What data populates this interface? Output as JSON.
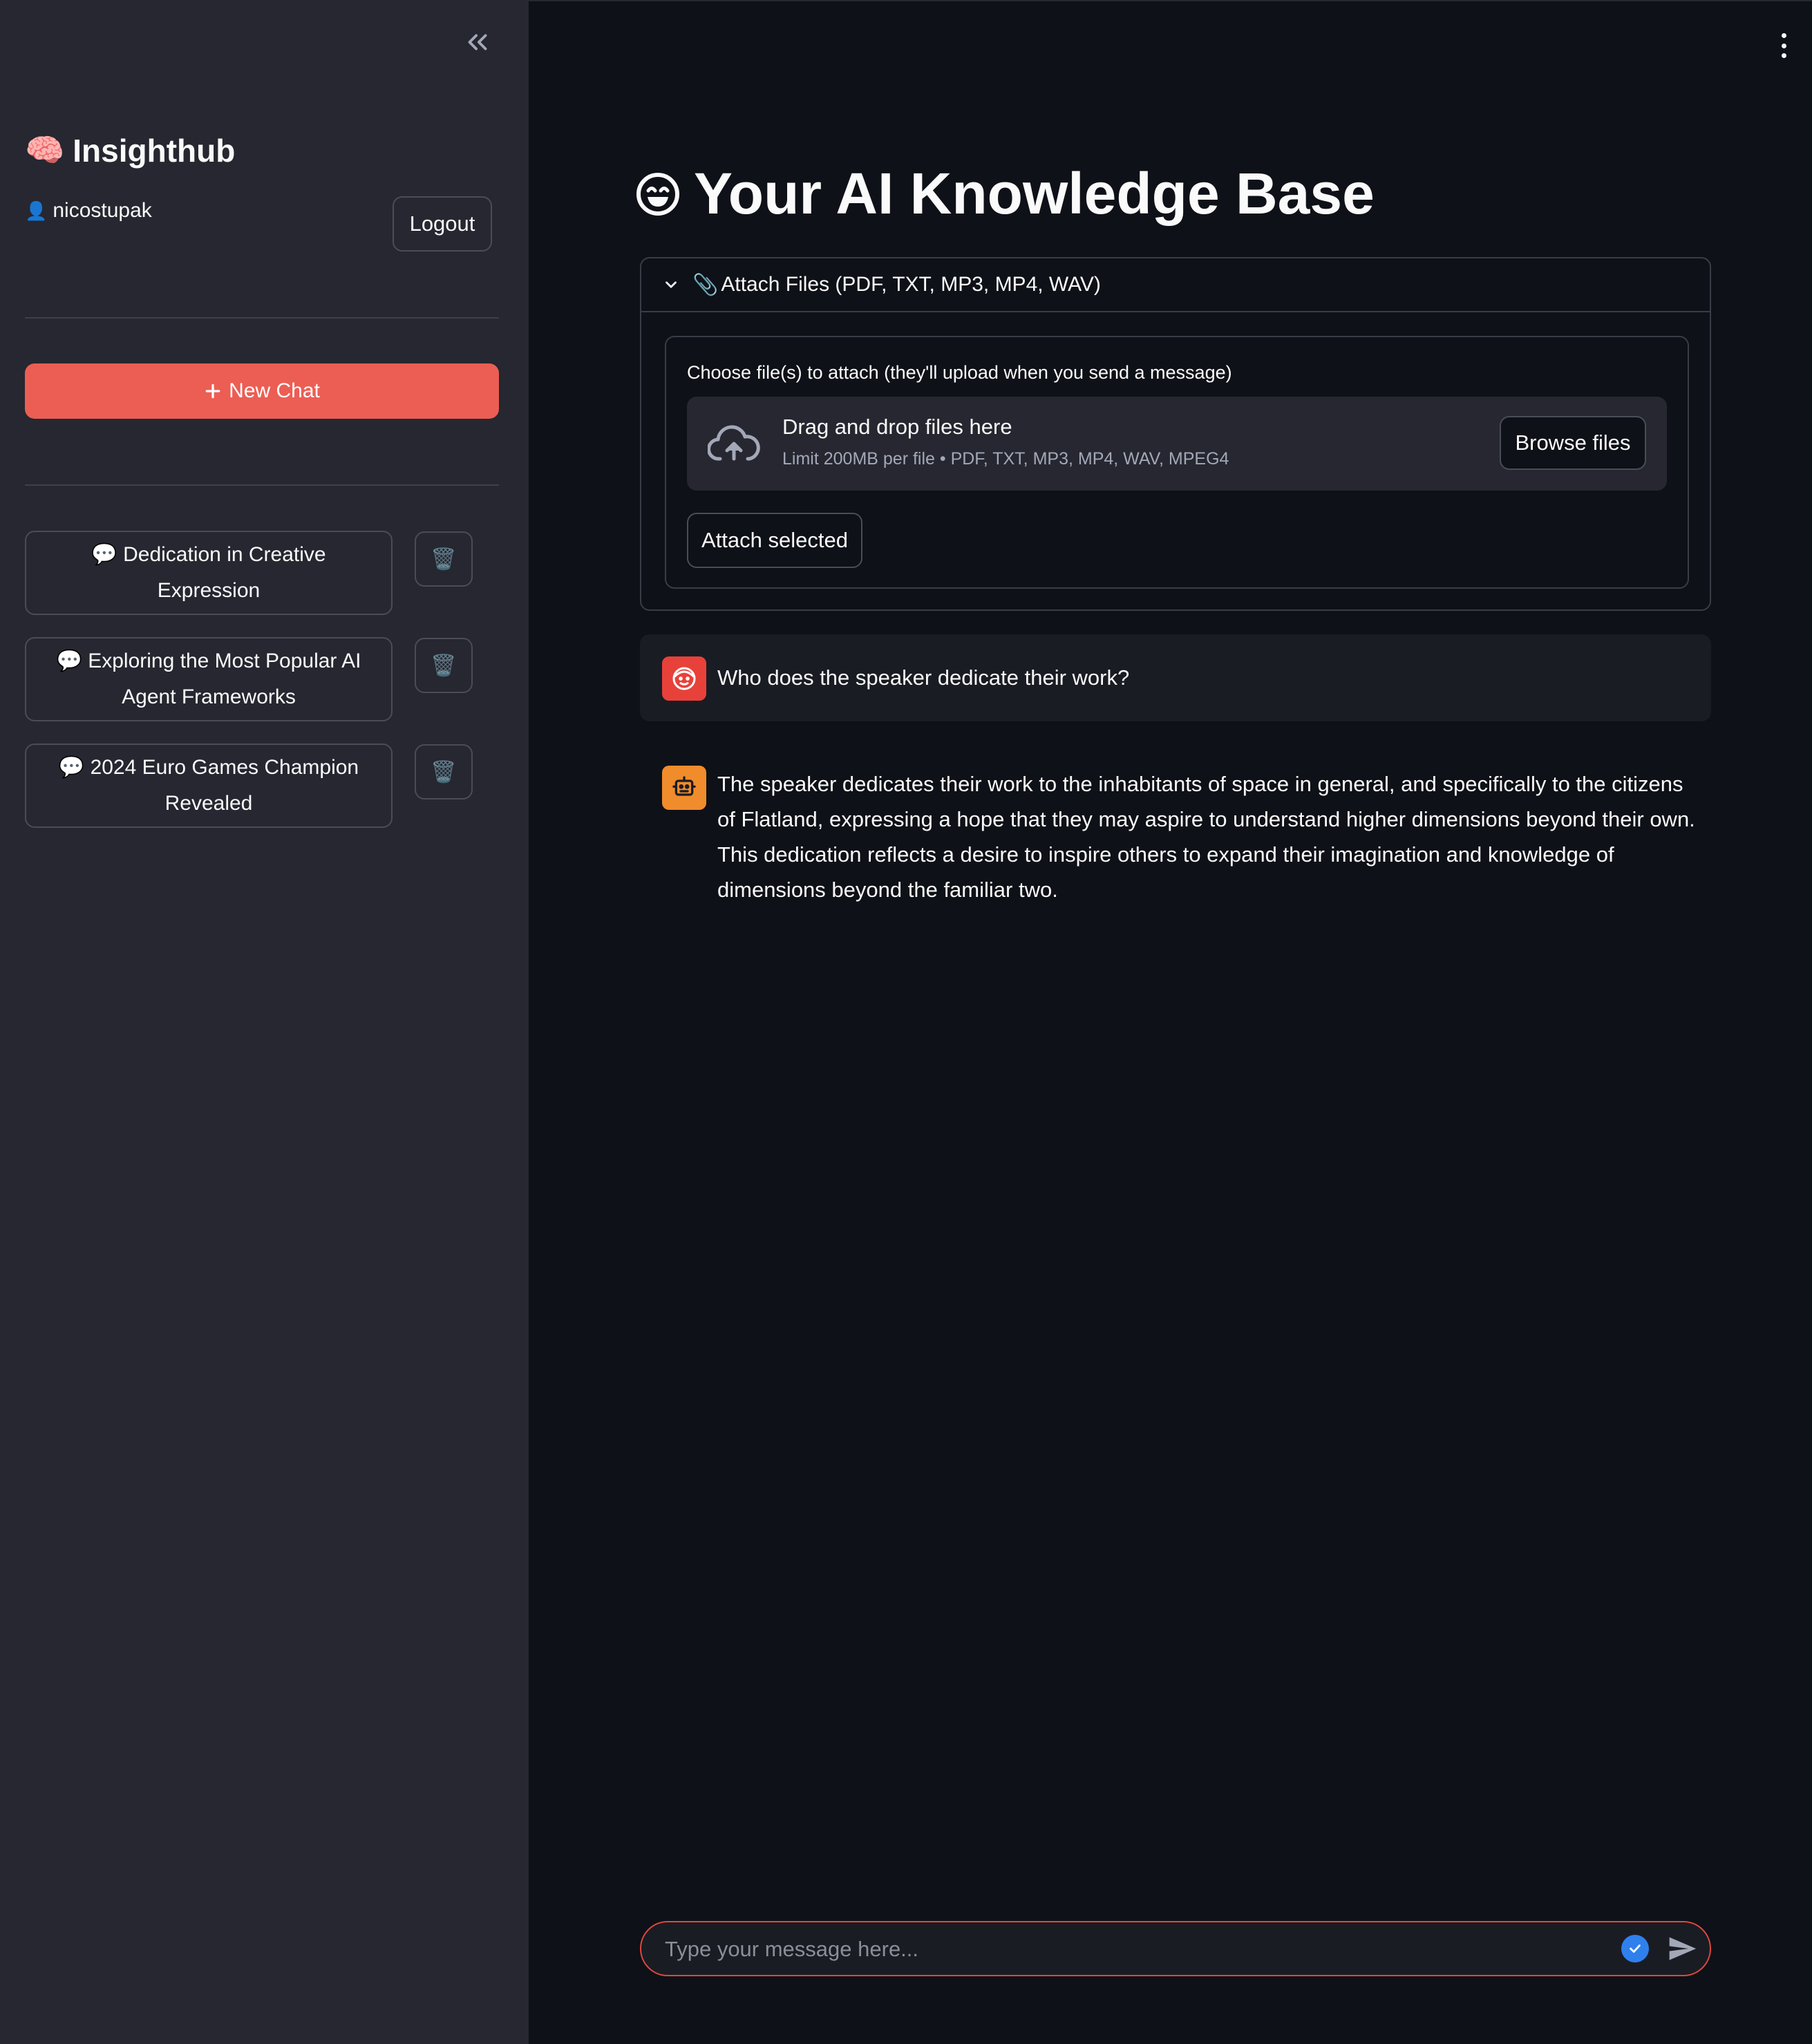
{
  "sidebar": {
    "brand_emoji": "🧠",
    "brand": "Insighthub",
    "user_emoji": "👤",
    "username": "nicostupak",
    "logout_label": "Logout",
    "new_chat_label": "New Chat",
    "chats": [
      {
        "icon": "💬",
        "title": "Dedication in Creative Expression"
      },
      {
        "icon": "💬",
        "title": "Exploring the Most Popular AI Agent Frameworks"
      },
      {
        "icon": "💬",
        "title": "2024 Euro Games Champion Revealed"
      }
    ],
    "trash_icon": "🗑️"
  },
  "main": {
    "title": "Your AI Knowledge Base",
    "title_icon": "grinning-face-icon",
    "expander": {
      "icon": "📎",
      "label": "Attach Files (PDF, TXT, MP3, MP4, WAV)",
      "uploader_label": "Choose file(s) to attach (they'll upload when you send a message)",
      "drop_main": "Drag and drop files here",
      "drop_sub": "Limit 200MB per file • PDF, TXT, MP3, MP4, WAV, MPEG4",
      "browse_label": "Browse files",
      "attach_selected_label": "Attach selected"
    },
    "messages": [
      {
        "role": "user",
        "text": "Who does the speaker dedicate their work?"
      },
      {
        "role": "assistant",
        "text": "The speaker dedicates their work to the inhabitants of space in general, and specifically to the citizens of Flatland, expressing a hope that they may aspire to understand higher dimensions beyond their own. This dedication reflects a desire to inspire others to expand their imagination and knowledge of dimensions beyond the familiar two."
      }
    ],
    "input_placeholder": "Type your message here..."
  },
  "colors": {
    "sidebar_bg": "#262730",
    "main_bg": "#0e1117",
    "accent": "#ec5e54",
    "user_avatar": "#e8413a",
    "assistant_avatar": "#f08c2c",
    "check": "#2f80ed"
  }
}
